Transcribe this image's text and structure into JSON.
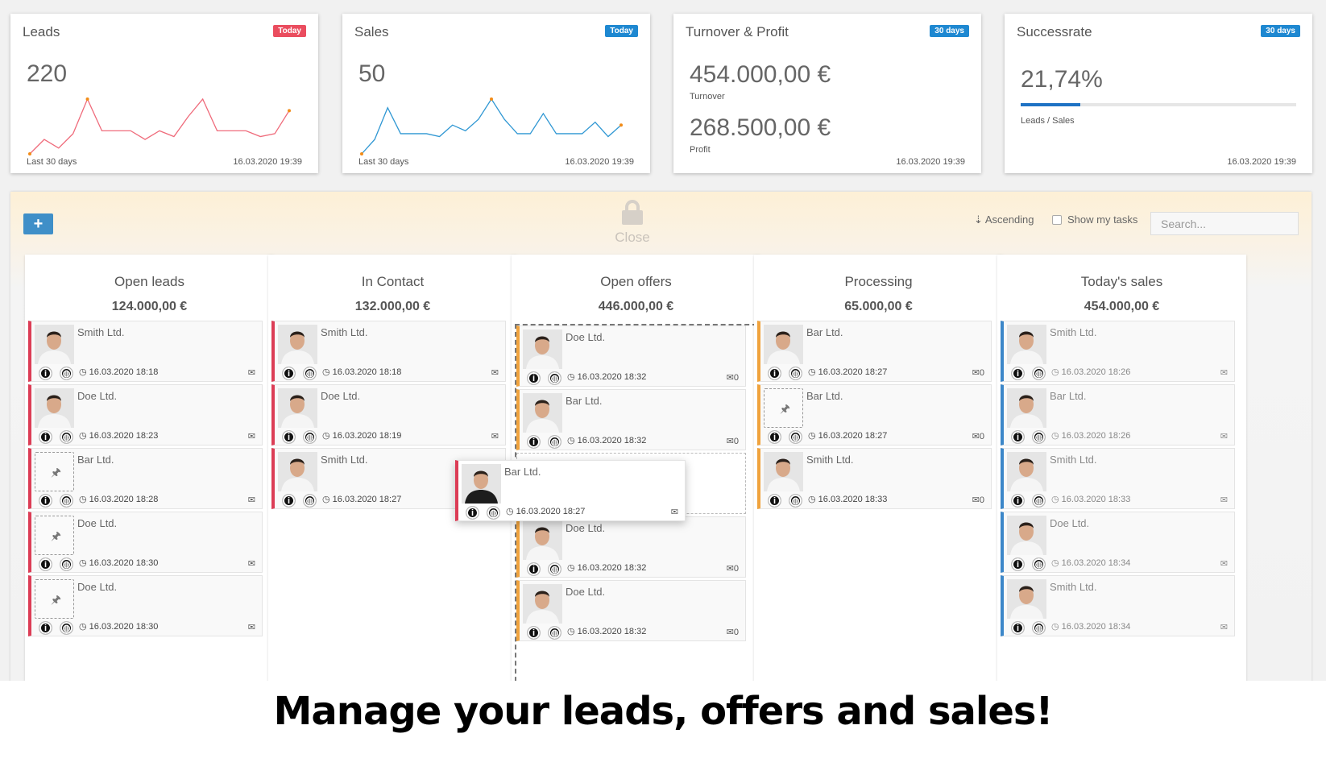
{
  "stats": {
    "leads": {
      "title": "Leads",
      "badge": "Today",
      "value": "220",
      "foot_left": "Last 30 days",
      "foot_right": "16.03.2020 19:39",
      "sparkline": [
        1,
        6,
        3,
        8,
        20,
        9,
        9,
        9,
        6,
        9,
        7,
        14,
        20,
        9,
        9,
        9,
        7,
        8,
        16
      ]
    },
    "sales": {
      "title": "Sales",
      "badge": "Today",
      "value": "50",
      "foot_left": "Last 30 days",
      "foot_right": "16.03.2020 19:39",
      "sparkline": [
        1,
        6,
        17,
        8,
        8,
        8,
        7,
        11,
        9,
        13,
        20,
        13,
        8,
        8,
        15,
        8,
        8,
        8,
        12,
        7,
        11
      ]
    },
    "turnover": {
      "title": "Turnover & Profit",
      "badge": "30 days",
      "turnover_value": "454.000,00 €",
      "turnover_label": "Turnover",
      "profit_value": "268.500,00 €",
      "profit_label": "Profit",
      "foot_right": "16.03.2020 19:39"
    },
    "successrate": {
      "title": "Successrate",
      "badge": "30 days",
      "value": "21,74%",
      "progress": 0.2174,
      "label": "Leads / Sales",
      "foot_right": "16.03.2020 19:39"
    }
  },
  "toolbar": {
    "add_label": "+",
    "lock_label": "Close",
    "sort_label": "Ascending",
    "tasks_label": "Show my tasks",
    "search_placeholder": "Search..."
  },
  "columns": [
    {
      "title": "Open leads",
      "sum": "124.000,00 €",
      "accent": "#dc3d56",
      "cards": [
        {
          "company": "Smith Ltd.",
          "time": "16.03.2020 18:18",
          "mail": "",
          "avatar": "photo"
        },
        {
          "company": "Doe Ltd.",
          "time": "16.03.2020 18:23",
          "mail": "",
          "avatar": "photo"
        },
        {
          "company": "Bar Ltd.",
          "time": "16.03.2020 18:28",
          "mail": "",
          "avatar": "pin"
        },
        {
          "company": "Doe Ltd.",
          "time": "16.03.2020 18:30",
          "mail": "",
          "avatar": "pin"
        },
        {
          "company": "Doe Ltd.",
          "time": "16.03.2020 18:30",
          "mail": "",
          "avatar": "pin"
        }
      ]
    },
    {
      "title": "In Contact",
      "sum": "132.000,00 €",
      "accent": "#dc3d56",
      "cards": [
        {
          "company": "Smith Ltd.",
          "time": "16.03.2020 18:18",
          "mail": "",
          "avatar": "photo"
        },
        {
          "company": "Doe Ltd.",
          "time": "16.03.2020 18:19",
          "mail": "",
          "avatar": "photo"
        },
        {
          "company": "Smith Ltd.",
          "time": "16.03.2020 18:27",
          "mail": "",
          "avatar": "photo"
        }
      ]
    },
    {
      "title": "Open offers",
      "sum": "446.000,00 €",
      "accent": "#f0a33d",
      "cards": [
        {
          "company": "Doe Ltd.",
          "time": "16.03.2020 18:32",
          "mail": "0",
          "avatar": "photo"
        },
        {
          "company": "Bar Ltd.",
          "time": "16.03.2020 18:32",
          "mail": "0",
          "avatar": "photo"
        },
        {
          "company": "Doe Ltd.",
          "time": "16.03.2020 18:32",
          "mail": "0",
          "avatar": "photo"
        },
        {
          "company": "Doe Ltd.",
          "time": "16.03.2020 18:32",
          "mail": "0",
          "avatar": "photo"
        }
      ]
    },
    {
      "title": "Processing",
      "sum": "65.000,00 €",
      "accent": "#f0a33d",
      "cards": [
        {
          "company": "Bar Ltd.",
          "time": "16.03.2020 18:27",
          "mail": "0",
          "avatar": "photo"
        },
        {
          "company": "Bar Ltd.",
          "time": "16.03.2020 18:27",
          "mail": "0",
          "avatar": "pin"
        },
        {
          "company": "Smith Ltd.",
          "time": "16.03.2020 18:33",
          "mail": "0",
          "avatar": "photo"
        }
      ]
    },
    {
      "title": "Today's sales",
      "sum": "454.000,00 €",
      "accent": "#3c87c9",
      "cards": [
        {
          "company": "Smith Ltd.",
          "time": "16.03.2020 18:26",
          "mail": "",
          "avatar": "photo"
        },
        {
          "company": "Bar Ltd.",
          "time": "16.03.2020 18:26",
          "mail": "",
          "avatar": "photo"
        },
        {
          "company": "Smith Ltd.",
          "time": "16.03.2020 18:33",
          "mail": "",
          "avatar": "photo"
        },
        {
          "company": "Doe Ltd.",
          "time": "16.03.2020 18:34",
          "mail": "",
          "avatar": "photo"
        },
        {
          "company": "Smith Ltd.",
          "time": "16.03.2020 18:34",
          "mail": "",
          "avatar": "photo"
        }
      ]
    }
  ],
  "dragged_card": {
    "company": "Bar Ltd.",
    "time": "16.03.2020 18:27",
    "mail": "",
    "avatar": "photo"
  },
  "caption": "Manage your leads, offers and sales!"
}
